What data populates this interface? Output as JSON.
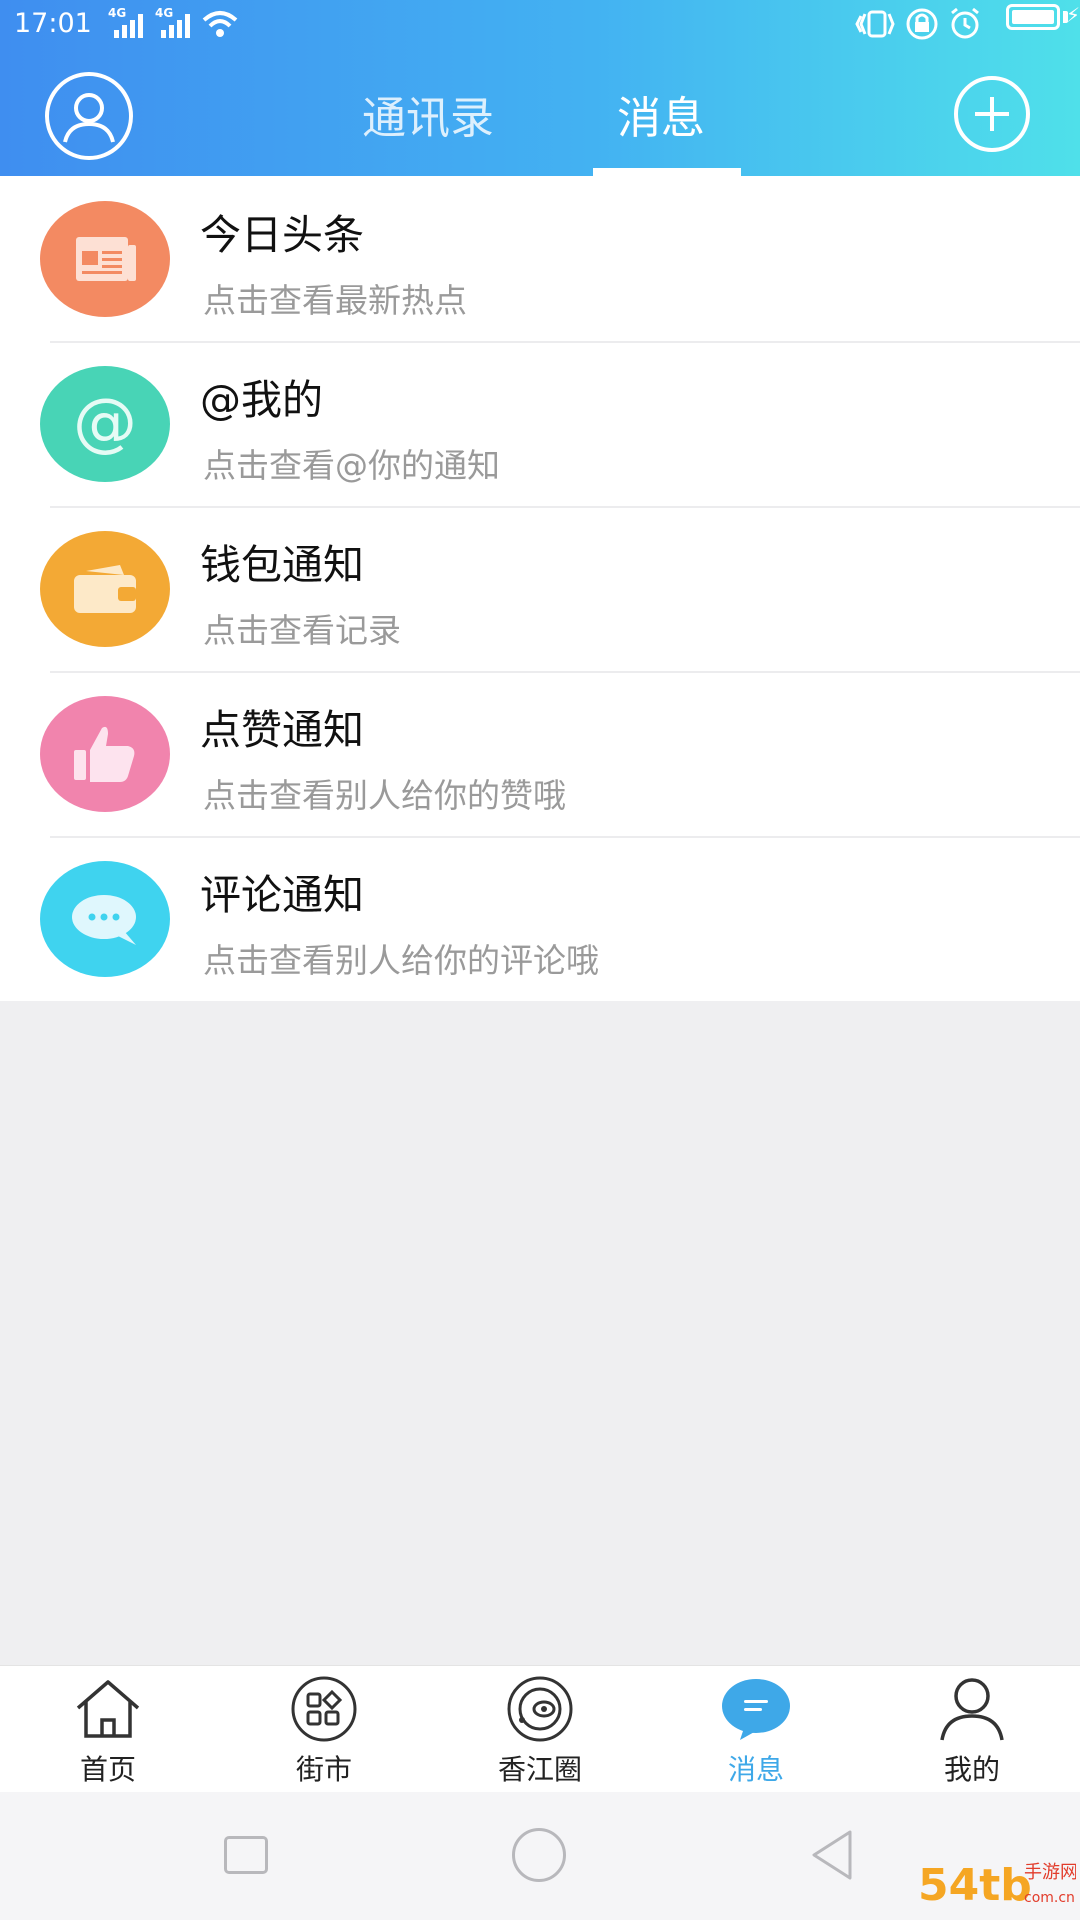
{
  "status_bar": {
    "time": "17:01",
    "network_1": "4G",
    "network_2": "4G",
    "icons": [
      "vibrate-icon",
      "lock-icon",
      "alarm-icon",
      "battery-icon",
      "charging-icon"
    ]
  },
  "header": {
    "tabs": [
      {
        "label": "通讯录",
        "selected": false
      },
      {
        "label": "消息",
        "selected": true
      }
    ],
    "left_icon": "user-avatar-icon",
    "right_icon": "plus-icon"
  },
  "messages": [
    {
      "title": "今日头条",
      "subtitle": "点击查看最新热点",
      "icon": "newspaper-icon",
      "color": "#f38a62"
    },
    {
      "title": "@我的",
      "subtitle": "点击查看@你的通知",
      "icon": "at-sign-icon",
      "color": "#48d4b6"
    },
    {
      "title": "钱包通知",
      "subtitle": "点击查看记录",
      "icon": "wallet-icon",
      "color": "#f3a935"
    },
    {
      "title": "点赞通知",
      "subtitle": "点击查看别人给你的赞哦",
      "icon": "thumbs-up-icon",
      "color": "#f184ad"
    },
    {
      "title": "评论通知",
      "subtitle": "点击查看别人给你的评论哦",
      "icon": "comment-bubble-icon",
      "color": "#3fd3ef"
    }
  ],
  "bottom_nav": [
    {
      "label": "首页",
      "icon": "home-icon",
      "active": false
    },
    {
      "label": "街市",
      "icon": "grid-apps-icon",
      "active": false
    },
    {
      "label": "香江圈",
      "icon": "orbit-circle-icon",
      "active": false
    },
    {
      "label": "消息",
      "icon": "chat-bubble-icon",
      "active": true
    },
    {
      "label": "我的",
      "icon": "person-icon",
      "active": false
    }
  ],
  "theme": {
    "header_gradient": [
      "#3f8ef0",
      "#4fe0ea"
    ],
    "active_nav": "#3ea8e8",
    "background": "#efeff1"
  },
  "watermark": {
    "text": "54tb手游网 com.cn"
  }
}
